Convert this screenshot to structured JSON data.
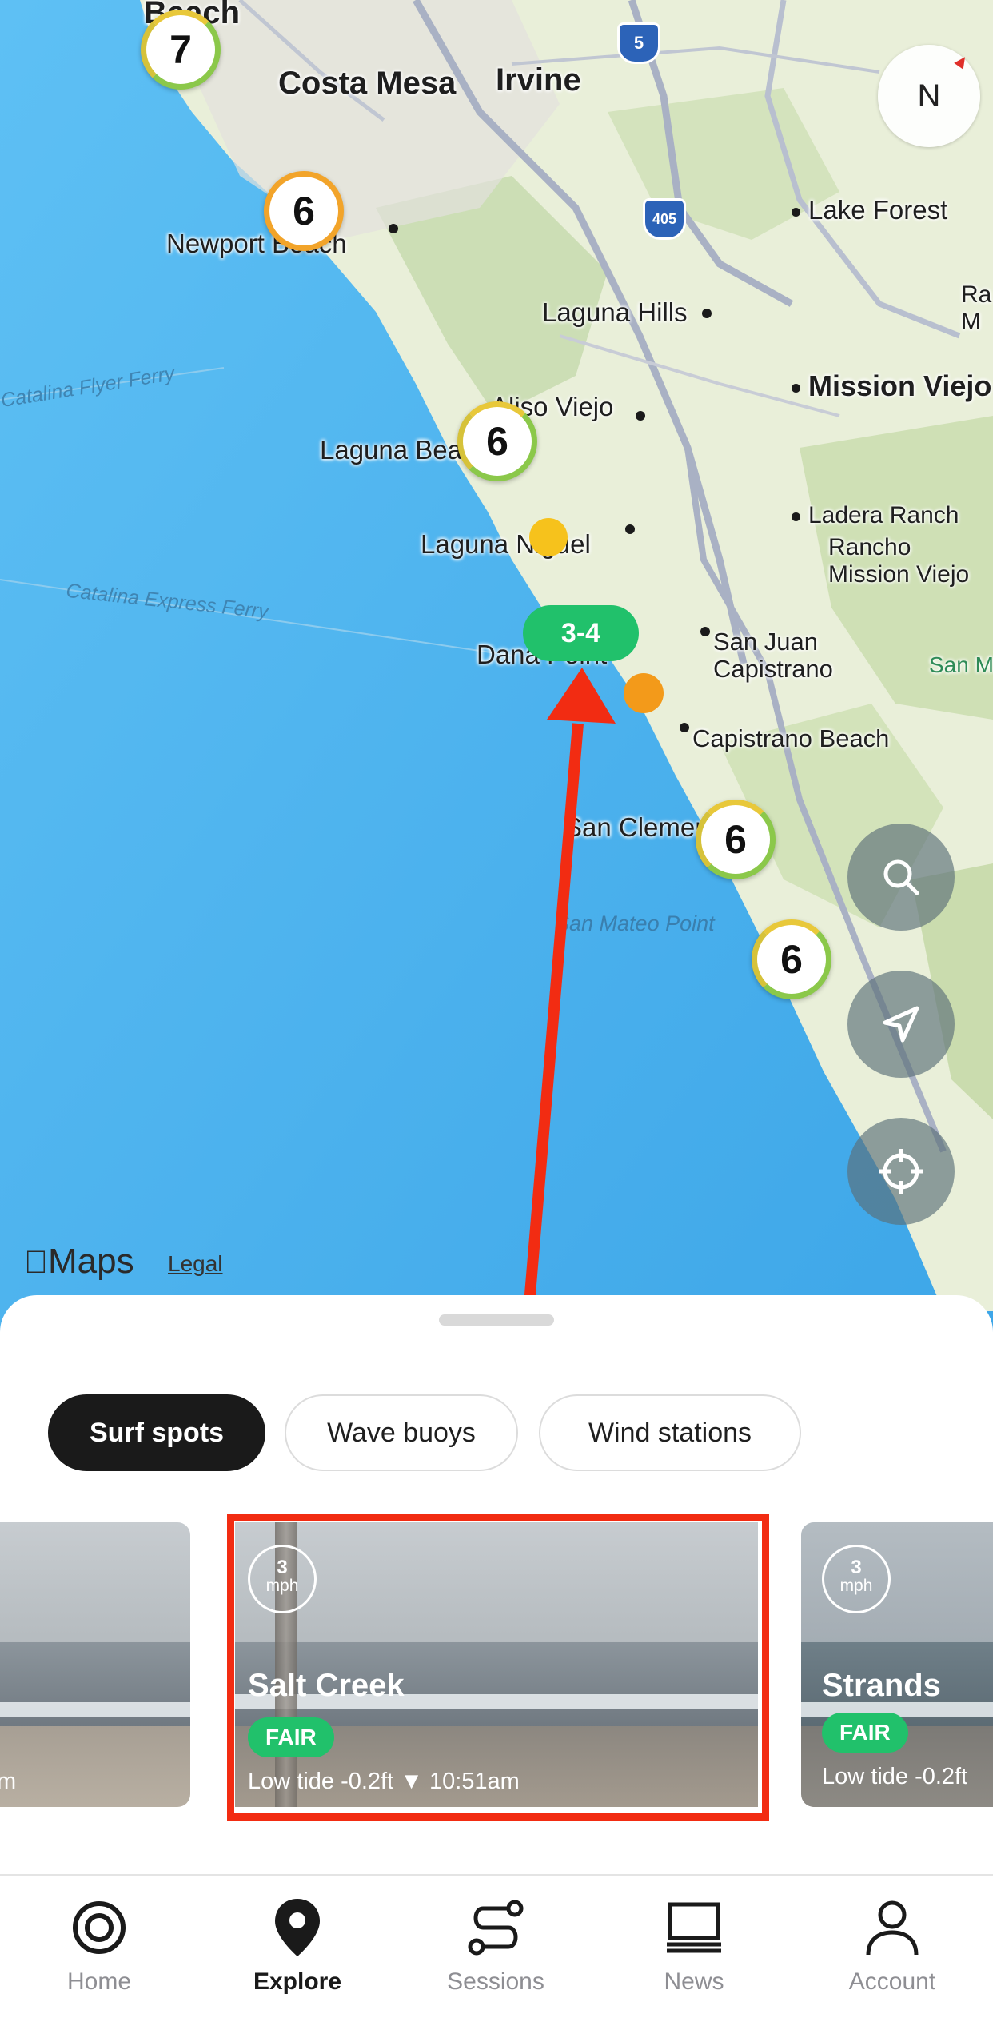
{
  "map": {
    "places": [
      {
        "key": "costa_mesa",
        "label": "Costa Mesa"
      },
      {
        "key": "irvine",
        "label": "Irvine"
      },
      {
        "key": "newport_beach",
        "label": "Newport Beach"
      },
      {
        "key": "lake_forest",
        "label": "Lake Forest"
      },
      {
        "key": "laguna_hills",
        "label": "Laguna Hills"
      },
      {
        "key": "mission_viejo",
        "label": "Mission Viejo"
      },
      {
        "key": "aliso_viejo",
        "label": "Aliso Viejo"
      },
      {
        "key": "laguna_beach",
        "label": "Laguna Beach"
      },
      {
        "key": "laguna_niguel",
        "label": "Laguna Niguel"
      },
      {
        "key": "ladera_ranch",
        "label": "Ladera Ranch"
      },
      {
        "key": "rancho_mission_viejo",
        "label": "Rancho\nMission Viejo"
      },
      {
        "key": "dana_point",
        "label": "Dana Point"
      },
      {
        "key": "san_juan_capistrano",
        "label": "San Juan\nCapistrano"
      },
      {
        "key": "capistrano_beach",
        "label": "Capistrano Beach"
      },
      {
        "key": "san_clemente",
        "label": "San Clemente"
      },
      {
        "key": "san_mateo_point",
        "label": "San Mateo Point"
      },
      {
        "key": "catalina_flyer_ferry",
        "label": "Catalina Flyer Ferry"
      },
      {
        "key": "catalina_express_ferry",
        "label": "Catalina Express Ferry"
      },
      {
        "key": "beach_top",
        "label": "Beach"
      },
      {
        "key": "ra_cut",
        "label": "Ra\nM"
      },
      {
        "key": "san_m_cut",
        "label": "San M"
      }
    ],
    "clusters": [
      "7",
      "6",
      "6",
      "6",
      "6"
    ],
    "highways": [
      "5",
      "405"
    ],
    "selected_spot_label": "3-4",
    "compass_label": "N",
    "logo_text": "Maps",
    "legal_text": "Legal"
  },
  "filters": [
    "Surf spots",
    "Wave buoys",
    "Wind stations"
  ],
  "active_filter": "Surf spots",
  "cards": [
    {
      "name": "",
      "wind_value": "",
      "wind_unit": "",
      "rating": "",
      "tide": "m"
    },
    {
      "name": "Salt Creek",
      "wind_value": "3",
      "wind_unit": "mph",
      "rating": "FAIR",
      "tide": "Low tide -0.2ft ▼ 10:51am"
    },
    {
      "name": "Strands",
      "wind_value": "3",
      "wind_unit": "mph",
      "rating": "FAIR",
      "tide": "Low tide -0.2ft"
    }
  ],
  "tabs": [
    {
      "label": "Home",
      "icon": "home-icon"
    },
    {
      "label": "Explore",
      "icon": "map-pin-icon"
    },
    {
      "label": "Sessions",
      "icon": "route-icon"
    },
    {
      "label": "News",
      "icon": "laptop-icon"
    },
    {
      "label": "Account",
      "icon": "person-icon"
    }
  ],
  "active_tab": "Explore",
  "colors": {
    "ocean": "#4fb3ee",
    "land": "#e9efd9",
    "rating_good": "#21c16b",
    "cluster_orange": "#f2a42a",
    "highlight_red": "#f22c12"
  }
}
